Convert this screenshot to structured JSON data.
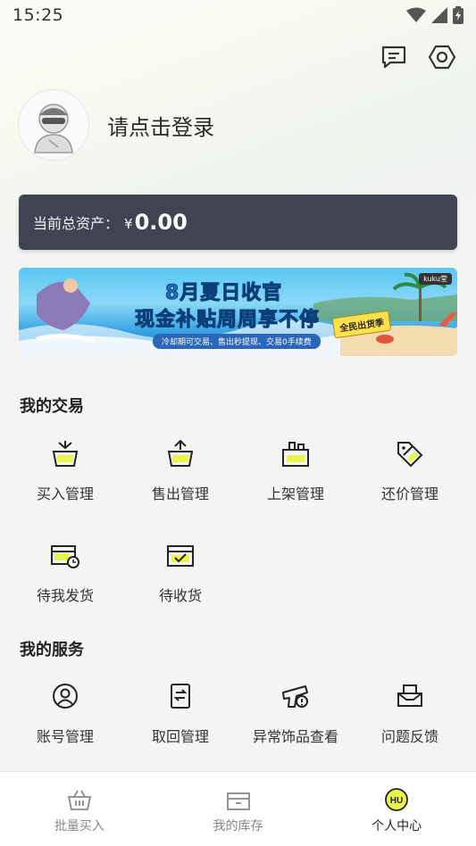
{
  "status": {
    "time": "15:25"
  },
  "profile": {
    "login_text": "请点击登录"
  },
  "asset": {
    "label": "当前总资产：",
    "currency": "¥",
    "value": "0.00"
  },
  "banner": {
    "title1": "8月夏日收官",
    "title2": "现金补贴周周享不停",
    "subtitle": "冷却期可交易、售出秒提现、交易0手续费",
    "tag": "全民出货季",
    "brand": "kuku堂"
  },
  "sections": {
    "trade": {
      "title": "我的交易",
      "items": [
        {
          "label": "买入管理",
          "icon": "basket-arrow-icon"
        },
        {
          "label": "售出管理",
          "icon": "basket-up-icon"
        },
        {
          "label": "上架管理",
          "icon": "box-shelf-icon"
        },
        {
          "label": "还价管理",
          "icon": "price-tag-icon"
        },
        {
          "label": "待我发货",
          "icon": "box-clock-icon"
        },
        {
          "label": "待收货",
          "icon": "box-check-icon"
        }
      ]
    },
    "service": {
      "title": "我的服务",
      "items": [
        {
          "label": "账号管理",
          "icon": "user-circle-icon"
        },
        {
          "label": "取回管理",
          "icon": "document-return-icon"
        },
        {
          "label": "异常饰品查看",
          "icon": "gun-warning-icon"
        },
        {
          "label": "问题反馈",
          "icon": "mailbox-icon"
        }
      ]
    }
  },
  "tabbar": {
    "items": [
      {
        "label": "批量买入",
        "icon": "basket-icon",
        "active": false
      },
      {
        "label": "我的库存",
        "icon": "inventory-box-icon",
        "active": false
      },
      {
        "label": "个人中心",
        "icon": "hu-badge-icon",
        "active": true
      }
    ]
  },
  "colors": {
    "accent": "#e8f54a",
    "card_bg": "#3f4352"
  }
}
